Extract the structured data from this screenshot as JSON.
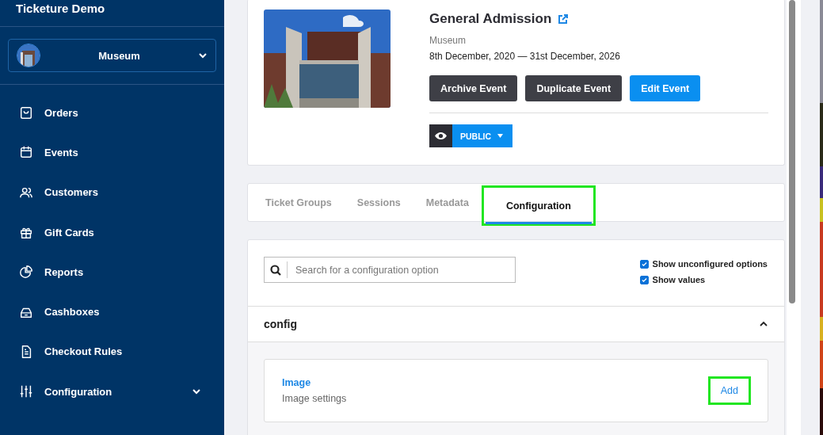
{
  "sidebar": {
    "app_title": "Ticketure Demo",
    "venue": {
      "name": "Museum"
    },
    "items": [
      {
        "label": "Orders",
        "kind": "bag"
      },
      {
        "label": "Events",
        "kind": "calendar"
      },
      {
        "label": "Customers",
        "kind": "users"
      },
      {
        "label": "Gift Cards",
        "kind": "gift"
      },
      {
        "label": "Reports",
        "kind": "pie"
      },
      {
        "label": "Cashboxes",
        "kind": "drawer"
      },
      {
        "label": "Checkout Rules",
        "kind": "doc"
      },
      {
        "label": "Configuration",
        "kind": "sliders",
        "expandable": true
      }
    ]
  },
  "event": {
    "title": "General Admission",
    "venue": "Museum",
    "dates": "8th December, 2020 — 31st December, 2026",
    "buttons": [
      {
        "label": "Archive Event",
        "kind": "dark"
      },
      {
        "label": "Duplicate Event",
        "kind": "dark"
      },
      {
        "label": "Edit Event",
        "kind": "primary"
      }
    ],
    "visibility": "PUBLIC"
  },
  "tabs": [
    {
      "label": "Ticket Groups",
      "selected": false,
      "highlighted": false
    },
    {
      "label": "Sessions",
      "selected": false,
      "highlighted": false
    },
    {
      "label": "Metadata",
      "selected": false,
      "highlighted": false
    },
    {
      "label": "Configuration",
      "selected": true,
      "highlighted": true
    }
  ],
  "config": {
    "search": {
      "placeholder": "Search for a configuration option"
    },
    "options": [
      {
        "label": "Show unconfigured options",
        "checked": true
      },
      {
        "label": "Show values",
        "checked": true
      }
    ],
    "section": {
      "title": "config",
      "expanded": true,
      "items": [
        {
          "title": "Image",
          "description": "Image settings",
          "action": "Add",
          "highlighted": true
        }
      ]
    }
  }
}
